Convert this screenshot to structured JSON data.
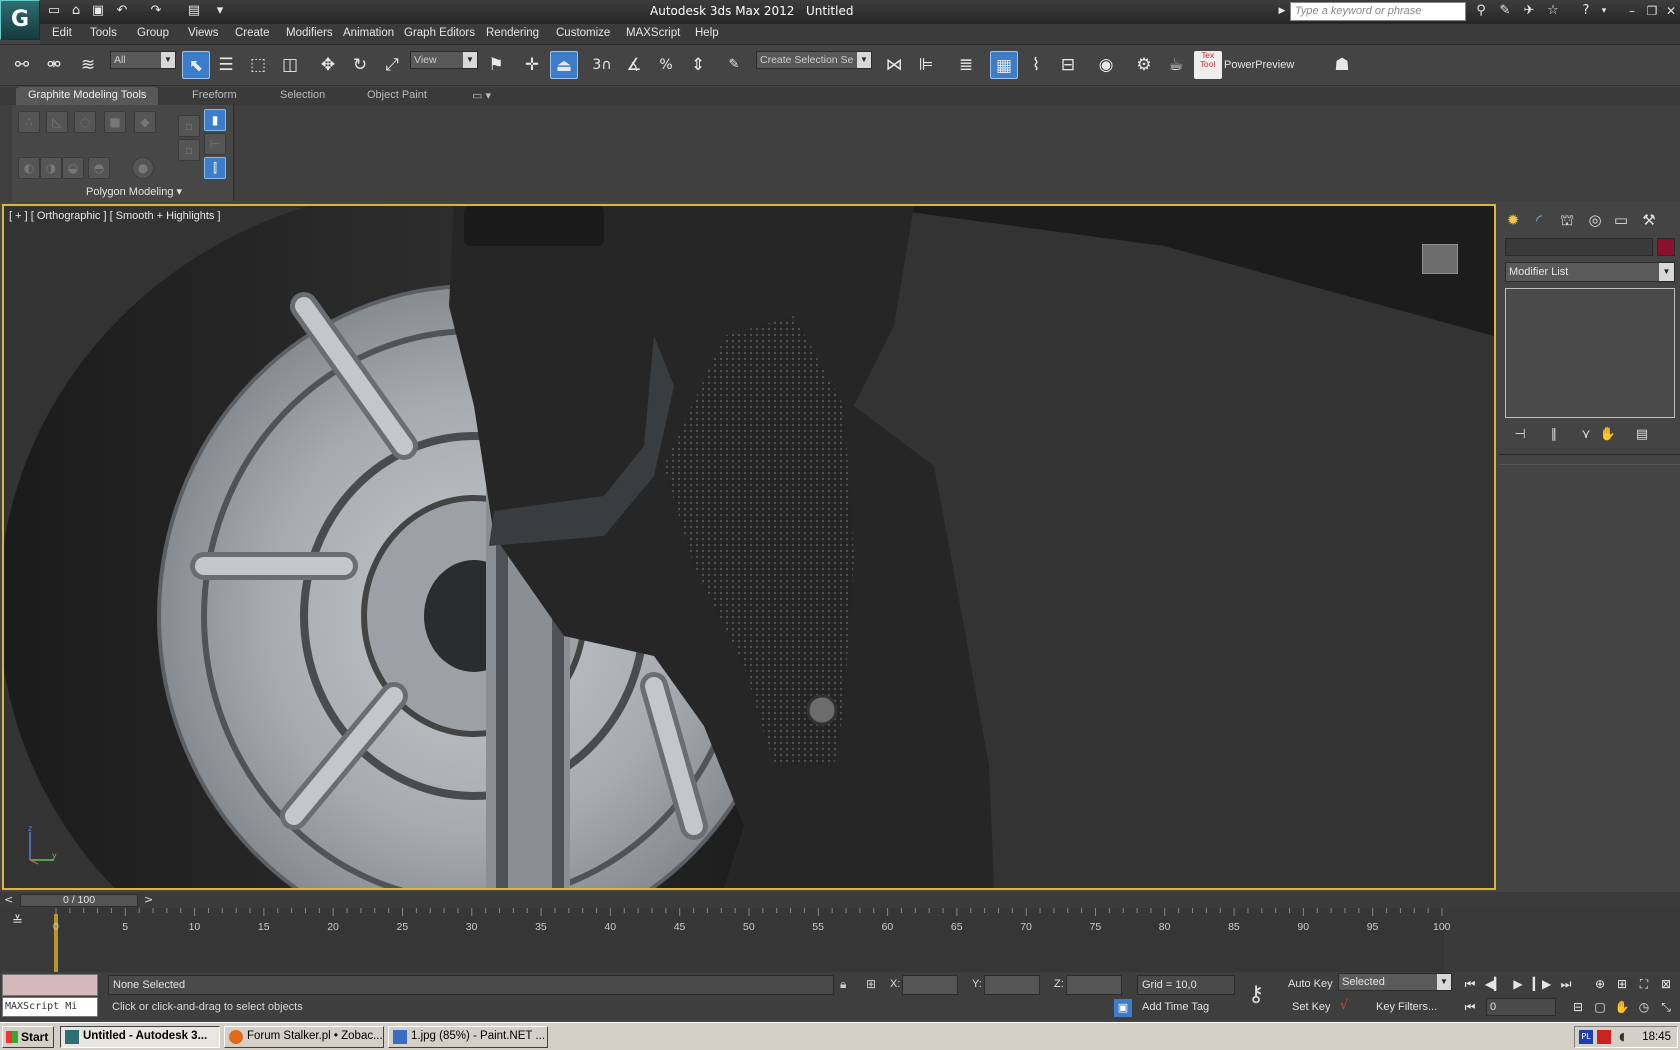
{
  "window": {
    "app_title": "Autodesk 3ds Max  2012",
    "document": "Untitled",
    "search_placeholder": "Type a keyword or phrase",
    "logo_letter": "G"
  },
  "menu": [
    "Edit",
    "Tools",
    "Group",
    "Views",
    "Create",
    "Modifiers",
    "Animation",
    "Graph Editors",
    "Rendering",
    "Customize",
    "MAXScript",
    "Help"
  ],
  "toolbar": {
    "filter_combo": "All",
    "refcoord_combo": "View",
    "selection_set_combo": "Create Selection Se",
    "snap_3": "3",
    "power_preview": "PowerPreview",
    "textool": "Tex\nTool"
  },
  "ribbon": {
    "tabs": [
      "Graphite Modeling Tools",
      "Freeform",
      "Selection",
      "Object Paint"
    ],
    "group_label": "Polygon Modeling"
  },
  "viewport": {
    "label": "[ + ] [ Orthographic ] [ Smooth + Highlights ]",
    "axis_z": "z",
    "axis_y": "y",
    "axis_x": "x"
  },
  "command_panel": {
    "modifier_list": "Modifier List"
  },
  "timeline": {
    "slider_text": "0 / 100",
    "prev": "<",
    "next": ">",
    "ticks": [
      "0",
      "5",
      "10",
      "15",
      "20",
      "25",
      "30",
      "35",
      "40",
      "45",
      "50",
      "55",
      "60",
      "65",
      "70",
      "75",
      "80",
      "85",
      "90",
      "95",
      "100"
    ]
  },
  "status": {
    "maxscript_label": "MAXScript Mi",
    "selection_status": "None Selected",
    "prompt": "Click or click-and-drag to select objects",
    "x_label": "X:",
    "y_label": "Y:",
    "z_label": "Z:",
    "grid": "Grid = 10,0",
    "add_time_tag": "Add Time Tag",
    "auto_key": "Auto Key",
    "set_key": "Set Key",
    "key_filters": "Key Filters...",
    "selected_combo": "Selected",
    "frame": "0"
  },
  "taskbar": {
    "start": "Start",
    "tasks": [
      "Untitled - Autodesk 3...",
      "Forum Stalker.pl • Zobac...",
      "1.jpg (85%) - Paint.NET ..."
    ],
    "lang": "PL",
    "time": "18:45"
  },
  "colors": {
    "viewport_border": "#d9b640",
    "active_button": "#3d7cc9",
    "object_color": "#8a1030"
  }
}
